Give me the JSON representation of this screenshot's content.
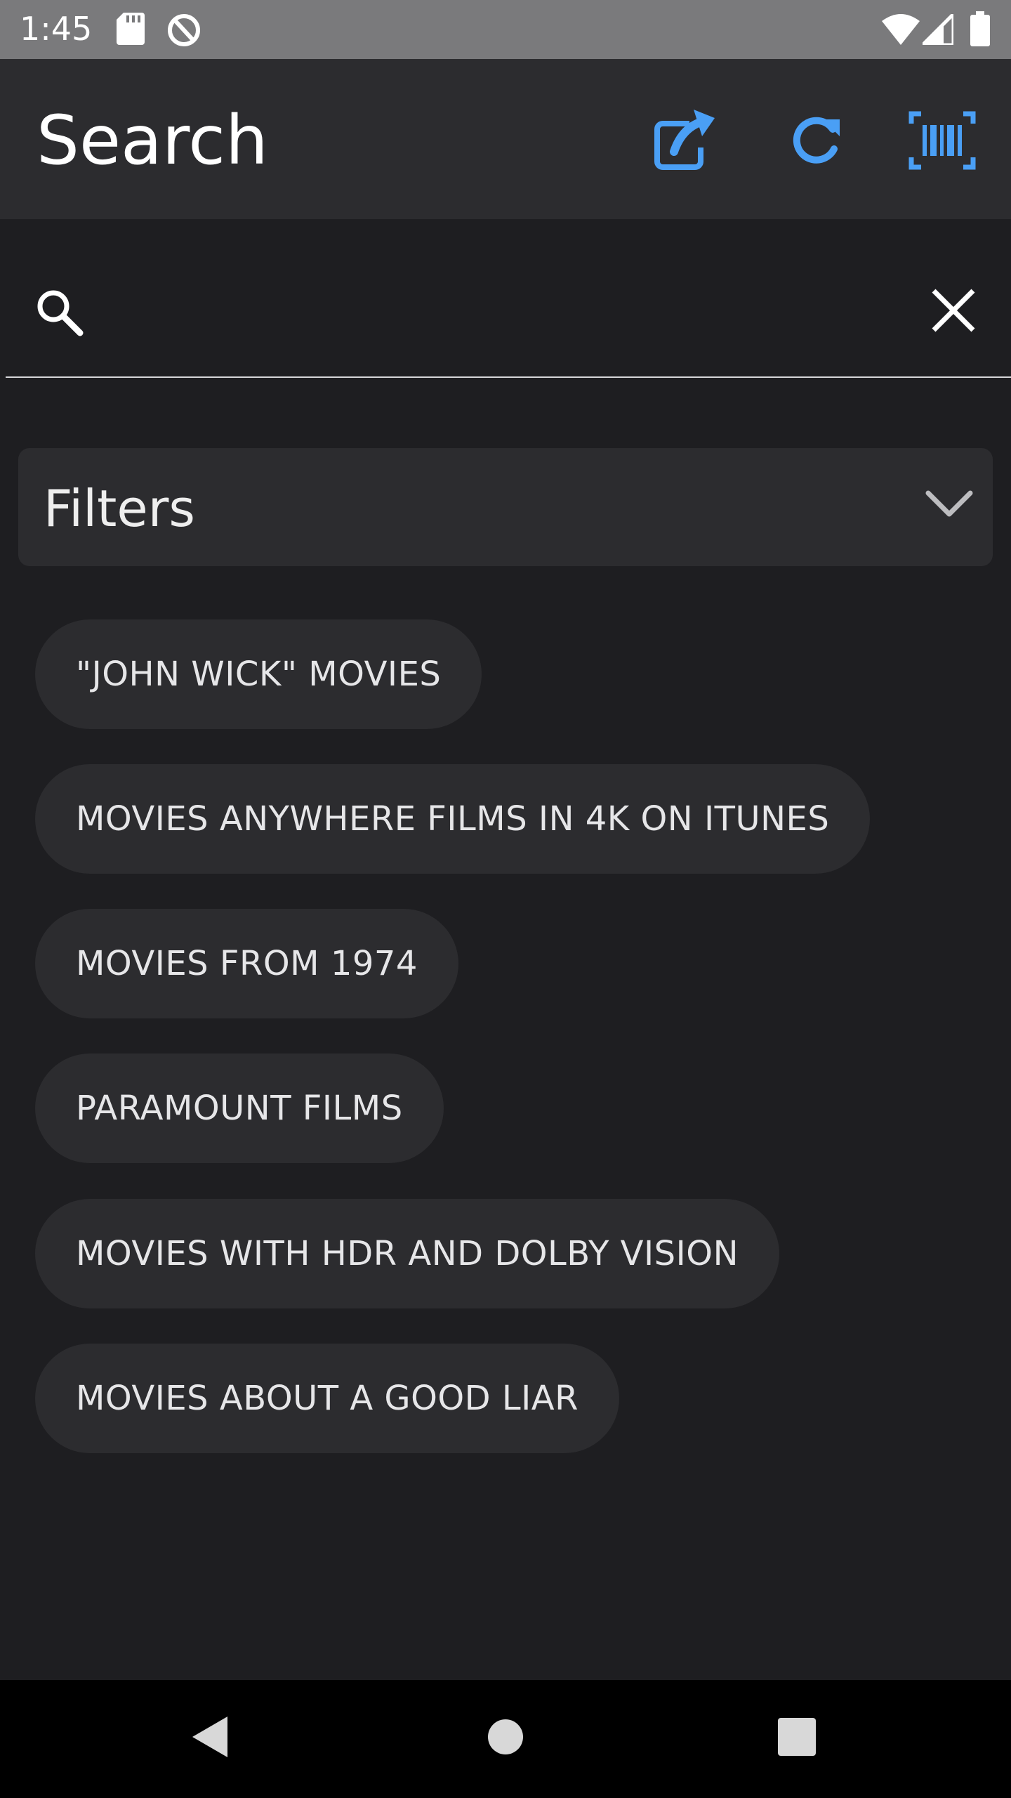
{
  "status_bar": {
    "time": "1:45",
    "icons": [
      "sd-card-icon",
      "data-saver-icon",
      "wifi-icon",
      "signal-icon",
      "battery-icon"
    ]
  },
  "app_bar": {
    "title": "Search",
    "actions": [
      "open-external-icon",
      "refresh-icon",
      "barcode-scan-icon"
    ],
    "accent_color": "#4a9ff5"
  },
  "search": {
    "value": "",
    "placeholder": ""
  },
  "filters": {
    "title": "Filters",
    "expanded": false
  },
  "suggestions": [
    "\"JOHN WICK\" MOVIES",
    "MOVIES ANYWHERE FILMS IN 4K ON ITUNES",
    "MOVIES FROM 1974",
    "PARAMOUNT FILMS",
    "MOVIES WITH HDR AND DOLBY VISION",
    "MOVIES ABOUT A GOOD LIAR"
  ],
  "nav_bar": {
    "buttons": [
      "back-icon",
      "home-icon",
      "recents-icon"
    ]
  }
}
